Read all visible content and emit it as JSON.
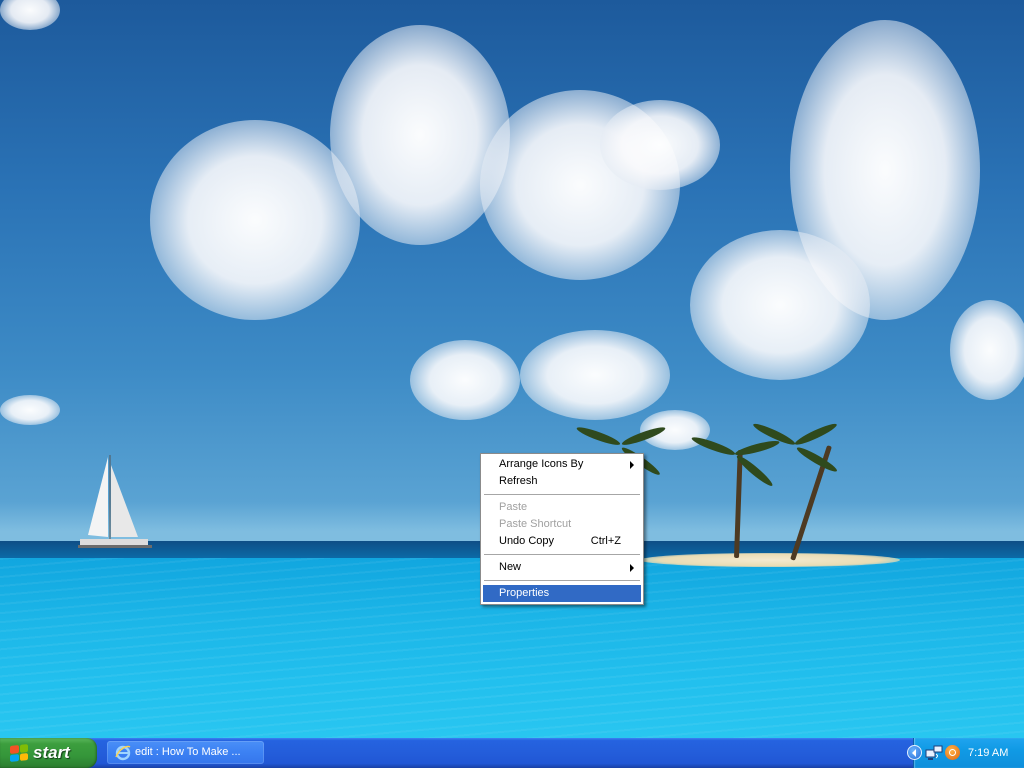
{
  "context_menu": {
    "items": [
      {
        "label": "Arrange Icons By",
        "submenu": true
      },
      {
        "label": "Refresh"
      },
      {
        "label": "Paste",
        "disabled": true
      },
      {
        "label": "Paste Shortcut",
        "disabled": true
      },
      {
        "label": "Undo Copy",
        "shortcut": "Ctrl+Z"
      },
      {
        "label": "New",
        "submenu": true
      },
      {
        "label": "Properties",
        "selected": true
      }
    ]
  },
  "taskbar": {
    "start_label": "start",
    "task_button_label": "edit : How To Make ...",
    "clock": "7:19 AM"
  },
  "icons": {
    "start_logo": "windows-flag-icon",
    "task_button_icon": "internet-explorer-icon",
    "tray_expand": "chevron-left-icon",
    "tray_network": "network-icon",
    "tray_app": "orange-circle-app-icon"
  },
  "colors": {
    "menu_highlight": "#316ac5",
    "taskbar_blue": "#245edb",
    "start_green": "#3c9e3e",
    "tray_blue": "#109ae5"
  }
}
